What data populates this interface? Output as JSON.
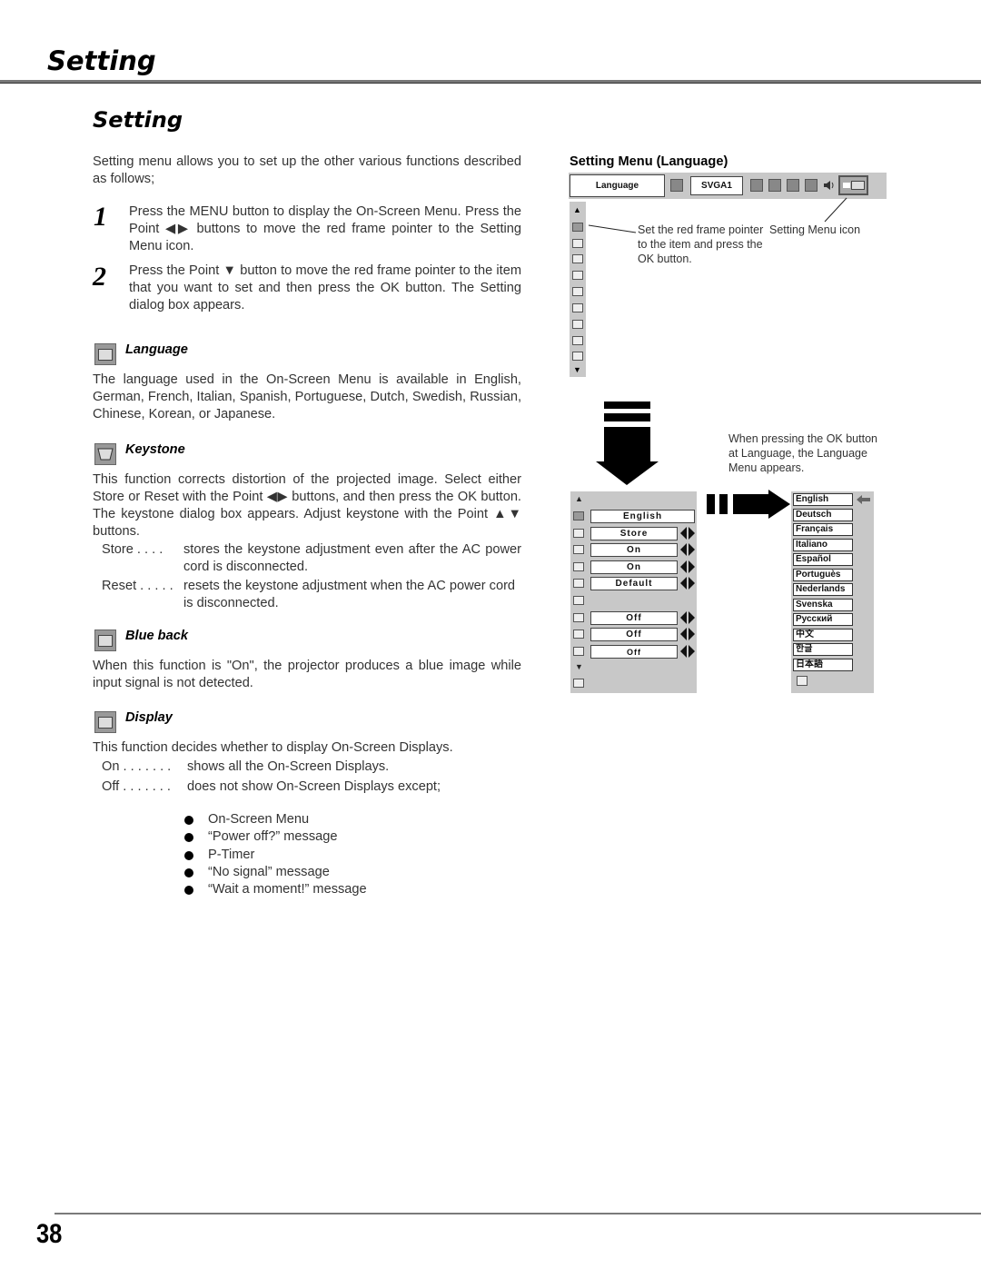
{
  "header": {
    "title": "Setting"
  },
  "section": {
    "title": "Setting"
  },
  "intro": "Setting menu allows you to set up the other various functions described as follows;",
  "steps": [
    {
      "num": "1",
      "text": "Press the MENU button to display the On-Screen Menu. Press the Point ◀▶ buttons to move the red frame pointer to the Setting Menu icon."
    },
    {
      "num": "2",
      "text": "Press the Point ▼ button to move the red frame pointer to the item that you want to set and then press the OK button. The Setting dialog box appears."
    }
  ],
  "language": {
    "title": "Language",
    "icon": "language-icon",
    "text": "The language used in the On-Screen Menu is available in English, German, French, Italian, Spanish, Portuguese, Dutch, Swedish, Russian, Chinese, Korean, or Japanese."
  },
  "keystone": {
    "title": "Keystone",
    "icon": "keystone-icon",
    "text": "This function corrects distortion of the projected image.  Select either Store or Reset with the Point ◀▶ buttons, and then press the OK button.  The keystone dialog box appears.  Adjust keystone with the Point ▲▼ buttons.",
    "defs": [
      {
        "term": "Store . . . .",
        "desc": "stores the keystone adjustment even after the AC power cord is disconnected."
      },
      {
        "term": "Reset . . . . .",
        "desc": "resets the keystone adjustment when the AC power cord is disconnected."
      }
    ]
  },
  "blueback": {
    "title": "Blue back",
    "icon": "blue-back-icon",
    "text": "When this function is \"On\", the projector produces a blue image while input signal is not detected."
  },
  "display": {
    "title": "Display",
    "icon": "display-icon",
    "text": "This function decides whether to display On-Screen Displays.",
    "defs": [
      {
        "term": "On  . . . . . . .",
        "desc": "shows all the On-Screen Displays."
      },
      {
        "term": "Off  . . . . . . .",
        "desc": "does not show On-Screen Displays except;"
      }
    ],
    "bullets": [
      "On-Screen Menu",
      "“Power off?” message",
      "P-Timer",
      "“No signal” message",
      "“Wait a moment!” message"
    ]
  },
  "figure": {
    "heading": "Setting Menu (Language)",
    "toolbar": {
      "label": "Language",
      "source": "SVGA1"
    },
    "callout_item": "Set the red frame pointer to the item and press the OK button.",
    "callout_icon": "Setting Menu icon",
    "callout_ok": "When pressing the OK button at Language, the Language Menu appears.",
    "menu_values": [
      "English",
      "Store",
      "On",
      "On",
      "Default",
      "",
      "Off",
      "Off",
      "Off"
    ],
    "languages": [
      "English",
      "Deutsch",
      "Français",
      "Italiano",
      "Español",
      "Portuguès",
      "Nederlands",
      "Svenska",
      "Русский",
      "中文",
      "한글",
      "日本語"
    ]
  },
  "footer": {
    "page_number": "38"
  }
}
